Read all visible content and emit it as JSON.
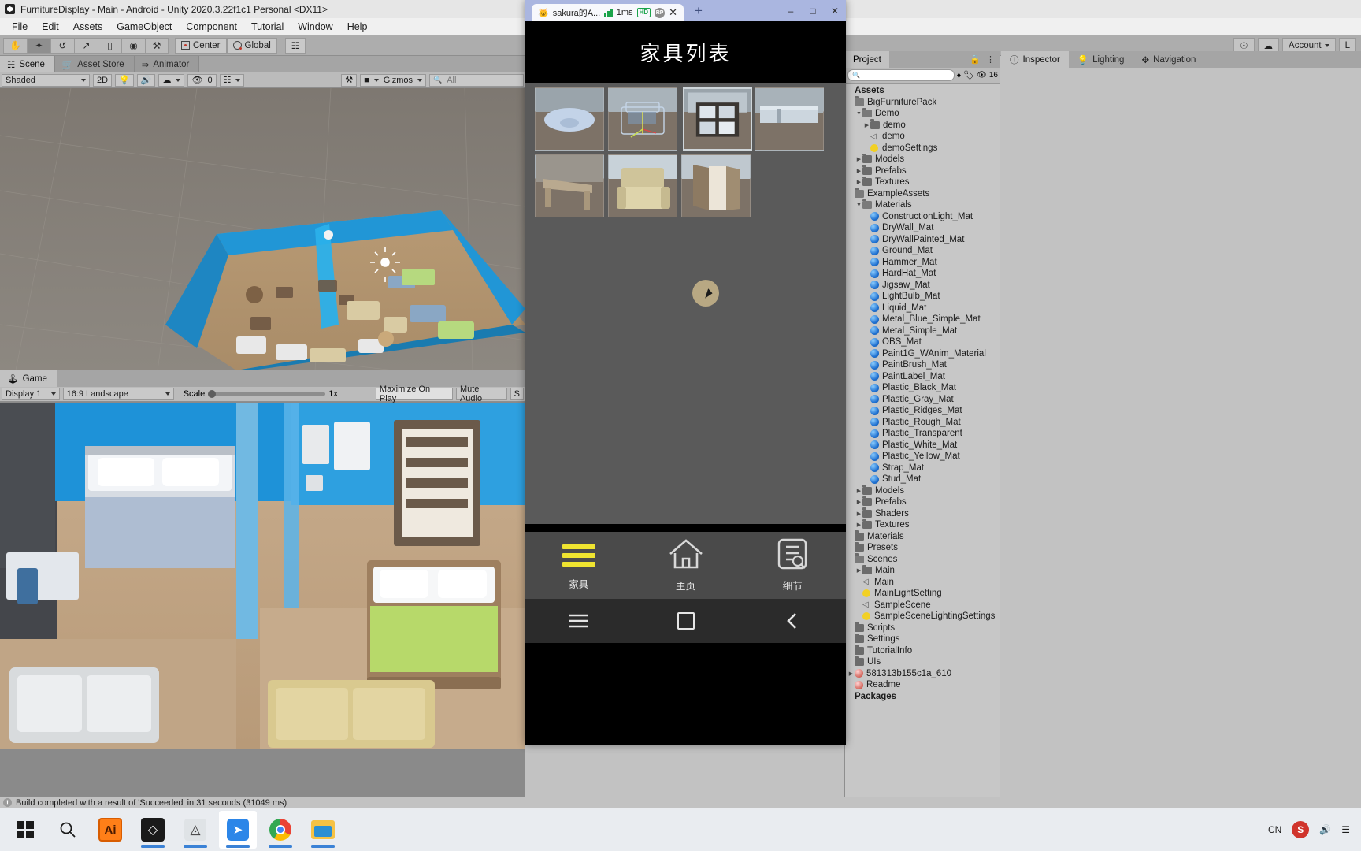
{
  "unity": {
    "window_title": "FurnitureDisplay - Main - Android - Unity 2020.3.22f1c1 Personal <DX11>",
    "menu": [
      "File",
      "Edit",
      "Assets",
      "GameObject",
      "Component",
      "Tutorial",
      "Window",
      "Help"
    ],
    "toolbar": {
      "tools": [
        "hand-tool",
        "move-tool",
        "rotate-tool",
        "scale-tool",
        "rect-tool",
        "transform-tool",
        "custom-tool"
      ],
      "pivot_label": "Center",
      "space_label": "Global",
      "account_label": "Account",
      "layers_label": "L"
    },
    "scene_view": {
      "tabs": [
        "Scene",
        "Asset Store",
        "Animator"
      ],
      "active_tab": "Scene",
      "draw_mode": "Shaded",
      "two_d": "2D",
      "hidden_count": "0",
      "gizmos_label": "Gizmos",
      "search_placeholder": "All"
    },
    "game_view": {
      "tab": "Game",
      "display": "Display 1",
      "aspect": "16:9 Landscape",
      "scale_label": "Scale",
      "scale_value": "1x",
      "maximize_label": "Maximize On Play",
      "mute_label": "Mute Audio",
      "stats_label": "S"
    },
    "status_bar": "Build completed with a result of 'Succeeded' in 31 seconds (31049 ms)",
    "project": {
      "tab": "Project",
      "search_placeholder": "",
      "visibility_count": "16",
      "tree": [
        {
          "label": "Assets",
          "depth": 0,
          "icon": "none",
          "arrow": "",
          "bold": true
        },
        {
          "label": "BigFurniturePack",
          "depth": 0,
          "icon": "folder-open",
          "arrow": ""
        },
        {
          "label": "Demo",
          "depth": 1,
          "icon": "folder-open",
          "arrow": "down"
        },
        {
          "label": "demo",
          "depth": 2,
          "icon": "folder",
          "arrow": "right"
        },
        {
          "label": "demo",
          "depth": 2,
          "icon": "scene",
          "arrow": ""
        },
        {
          "label": "demoSettings",
          "depth": 2,
          "icon": "light",
          "arrow": ""
        },
        {
          "label": "Models",
          "depth": 1,
          "icon": "folder",
          "arrow": "right"
        },
        {
          "label": "Prefabs",
          "depth": 1,
          "icon": "folder",
          "arrow": "right"
        },
        {
          "label": "Textures",
          "depth": 1,
          "icon": "folder",
          "arrow": "right"
        },
        {
          "label": "ExampleAssets",
          "depth": 0,
          "icon": "folder-open",
          "arrow": ""
        },
        {
          "label": "Materials",
          "depth": 1,
          "icon": "folder-open",
          "arrow": "down"
        },
        {
          "label": "ConstructionLight_Mat",
          "depth": 2,
          "icon": "material",
          "arrow": ""
        },
        {
          "label": "DryWall_Mat",
          "depth": 2,
          "icon": "material",
          "arrow": ""
        },
        {
          "label": "DryWallPainted_Mat",
          "depth": 2,
          "icon": "material",
          "arrow": ""
        },
        {
          "label": "Ground_Mat",
          "depth": 2,
          "icon": "material",
          "arrow": ""
        },
        {
          "label": "Hammer_Mat",
          "depth": 2,
          "icon": "material",
          "arrow": ""
        },
        {
          "label": "HardHat_Mat",
          "depth": 2,
          "icon": "material",
          "arrow": ""
        },
        {
          "label": "Jigsaw_Mat",
          "depth": 2,
          "icon": "material",
          "arrow": ""
        },
        {
          "label": "LightBulb_Mat",
          "depth": 2,
          "icon": "material",
          "arrow": ""
        },
        {
          "label": "Liquid_Mat",
          "depth": 2,
          "icon": "material",
          "arrow": ""
        },
        {
          "label": "Metal_Blue_Simple_Mat",
          "depth": 2,
          "icon": "material",
          "arrow": ""
        },
        {
          "label": "Metal_Simple_Mat",
          "depth": 2,
          "icon": "material",
          "arrow": ""
        },
        {
          "label": "OBS_Mat",
          "depth": 2,
          "icon": "material",
          "arrow": ""
        },
        {
          "label": "Paint1G_WAnim_Material",
          "depth": 2,
          "icon": "material",
          "arrow": ""
        },
        {
          "label": "PaintBrush_Mat",
          "depth": 2,
          "icon": "material",
          "arrow": ""
        },
        {
          "label": "PaintLabel_Mat",
          "depth": 2,
          "icon": "material",
          "arrow": ""
        },
        {
          "label": "Plastic_Black_Mat",
          "depth": 2,
          "icon": "material",
          "arrow": ""
        },
        {
          "label": "Plastic_Gray_Mat",
          "depth": 2,
          "icon": "material",
          "arrow": ""
        },
        {
          "label": "Plastic_Ridges_Mat",
          "depth": 2,
          "icon": "material",
          "arrow": ""
        },
        {
          "label": "Plastic_Rough_Mat",
          "depth": 2,
          "icon": "material",
          "arrow": ""
        },
        {
          "label": "Plastic_Transparent",
          "depth": 2,
          "icon": "material",
          "arrow": ""
        },
        {
          "label": "Plastic_White_Mat",
          "depth": 2,
          "icon": "material",
          "arrow": ""
        },
        {
          "label": "Plastic_Yellow_Mat",
          "depth": 2,
          "icon": "material",
          "arrow": ""
        },
        {
          "label": "Strap_Mat",
          "depth": 2,
          "icon": "material",
          "arrow": ""
        },
        {
          "label": "Stud_Mat",
          "depth": 2,
          "icon": "material",
          "arrow": ""
        },
        {
          "label": "Models",
          "depth": 1,
          "icon": "folder",
          "arrow": "right"
        },
        {
          "label": "Prefabs",
          "depth": 1,
          "icon": "folder",
          "arrow": "right"
        },
        {
          "label": "Shaders",
          "depth": 1,
          "icon": "folder",
          "arrow": "right"
        },
        {
          "label": "Textures",
          "depth": 1,
          "icon": "folder",
          "arrow": "right"
        },
        {
          "label": "Materials",
          "depth": 0,
          "icon": "folder",
          "arrow": ""
        },
        {
          "label": "Presets",
          "depth": 0,
          "icon": "folder",
          "arrow": ""
        },
        {
          "label": "Scenes",
          "depth": 0,
          "icon": "folder-open",
          "arrow": ""
        },
        {
          "label": "Main",
          "depth": 1,
          "icon": "folder",
          "arrow": "right"
        },
        {
          "label": "Main",
          "depth": 1,
          "icon": "scene",
          "arrow": ""
        },
        {
          "label": "MainLightSetting",
          "depth": 1,
          "icon": "light",
          "arrow": ""
        },
        {
          "label": "SampleScene",
          "depth": 1,
          "icon": "scene",
          "arrow": ""
        },
        {
          "label": "SampleSceneLightingSettings",
          "depth": 1,
          "icon": "light",
          "arrow": ""
        },
        {
          "label": "Scripts",
          "depth": 0,
          "icon": "folder",
          "arrow": ""
        },
        {
          "label": "Settings",
          "depth": 0,
          "icon": "folder",
          "arrow": ""
        },
        {
          "label": "TutorialInfo",
          "depth": 0,
          "icon": "folder",
          "arrow": ""
        },
        {
          "label": "UIs",
          "depth": 0,
          "icon": "folder",
          "arrow": ""
        },
        {
          "label": "581313b155c1a_610",
          "depth": 0,
          "icon": "package",
          "arrow": "right"
        },
        {
          "label": "Readme",
          "depth": 0,
          "icon": "readme",
          "arrow": ""
        },
        {
          "label": "Packages",
          "depth": 0,
          "icon": "none",
          "arrow": "",
          "bold": true
        }
      ]
    },
    "inspector": {
      "tabs": [
        "Inspector",
        "Lighting",
        "Navigation"
      ],
      "active_tab": "Inspector"
    }
  },
  "emulator": {
    "tab_title": "sakura的A...",
    "latency": "1ms",
    "hd_badge": "HD",
    "avatar": "RP",
    "close": "✕",
    "new_tab": "+",
    "win_minimize": "–",
    "win_maximize": "□",
    "win_close": "✕",
    "app_title": "家具列表",
    "grid_items": [
      {
        "name": "basin",
        "selected": false
      },
      {
        "name": "sofa-wireframe",
        "selected": false
      },
      {
        "name": "shelf-unit",
        "selected": true
      },
      {
        "name": "sideboard",
        "selected": false
      },
      {
        "name": "desk",
        "selected": false
      },
      {
        "name": "armchair",
        "selected": false
      },
      {
        "name": "wardrobe",
        "selected": false
      }
    ],
    "nav": [
      {
        "label": "家具",
        "icon": "hamburger-icon",
        "active": true
      },
      {
        "label": "主页",
        "icon": "home-icon",
        "active": false
      },
      {
        "label": "细节",
        "icon": "details-icon",
        "active": false
      }
    ],
    "system_nav": [
      "menu-icon",
      "home-square-icon",
      "back-icon"
    ]
  },
  "taskbar": {
    "items": [
      {
        "name": "start-button",
        "glyph": "windows"
      },
      {
        "name": "search-button",
        "glyph": "search"
      },
      {
        "name": "illustrator-app",
        "glyph": "Ai"
      },
      {
        "name": "unity-editor-app",
        "glyph": "unity"
      },
      {
        "name": "unity-hub-app",
        "glyph": "hub"
      },
      {
        "name": "emulator-app",
        "glyph": "emu"
      },
      {
        "name": "chrome-app",
        "glyph": "chrome"
      },
      {
        "name": "file-explorer-app",
        "glyph": "folder"
      }
    ],
    "tray": [
      "CN",
      "S",
      "speaker-icon",
      "network-icon"
    ]
  },
  "colors": {
    "accent_yellow": "#efe430",
    "emulator_title": "#aab6e0",
    "unity_panel": "#c2c2c2",
    "wall_blue": "#2196d6"
  }
}
